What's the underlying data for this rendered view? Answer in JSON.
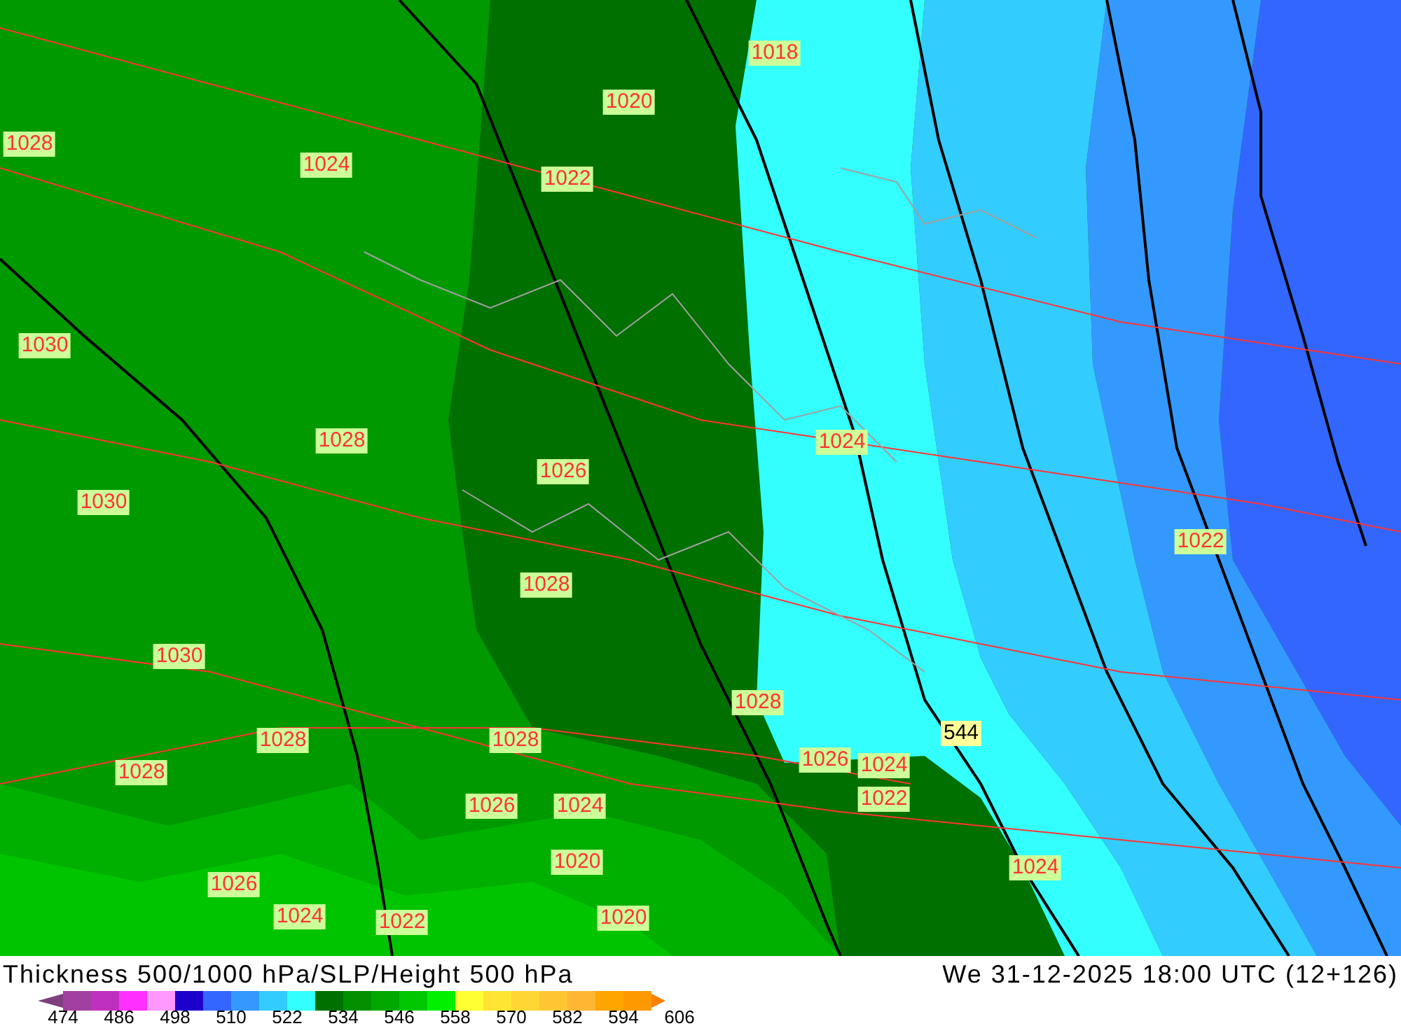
{
  "map": {
    "labels": [
      {
        "text": "1018",
        "kind": "pressure"
      },
      {
        "text": "1020",
        "kind": "pressure"
      },
      {
        "text": "1028",
        "kind": "pressure"
      },
      {
        "text": "1024",
        "kind": "pressure"
      },
      {
        "text": "1022",
        "kind": "pressure"
      },
      {
        "text": "1030",
        "kind": "pressure"
      },
      {
        "text": "1028",
        "kind": "pressure"
      },
      {
        "text": "1024",
        "kind": "pressure"
      },
      {
        "text": "1026",
        "kind": "pressure"
      },
      {
        "text": "1030",
        "kind": "pressure"
      },
      {
        "text": "1022",
        "kind": "pressure"
      },
      {
        "text": "1028",
        "kind": "pressure"
      },
      {
        "text": "1030",
        "kind": "pressure"
      },
      {
        "text": "1028",
        "kind": "pressure"
      },
      {
        "text": "544",
        "kind": "thickness"
      },
      {
        "text": "1028",
        "kind": "pressure"
      },
      {
        "text": "1028",
        "kind": "pressure"
      },
      {
        "text": "1026",
        "kind": "pressure"
      },
      {
        "text": "1024",
        "kind": "pressure"
      },
      {
        "text": "1028",
        "kind": "pressure"
      },
      {
        "text": "1022",
        "kind": "pressure"
      },
      {
        "text": "1026",
        "kind": "pressure"
      },
      {
        "text": "1024",
        "kind": "pressure"
      },
      {
        "text": "1020",
        "kind": "pressure"
      },
      {
        "text": "1024",
        "kind": "pressure"
      },
      {
        "text": "1026",
        "kind": "pressure"
      },
      {
        "text": "1024",
        "kind": "pressure"
      },
      {
        "text": "1022",
        "kind": "pressure"
      },
      {
        "text": "1020",
        "kind": "pressure"
      }
    ]
  },
  "title": "Thickness 500/1000 hPa/SLP/Height 500 hPa",
  "valid_time": "We 31-12-2025 18:00 UTC (12+126)",
  "legend": {
    "swatches": [
      {
        "color": "#a040a0"
      },
      {
        "color": "#c030c0"
      },
      {
        "color": "#ff30ff"
      },
      {
        "color": "#ff99ff"
      },
      {
        "color": "#1e00cc"
      },
      {
        "color": "#3366ff"
      },
      {
        "color": "#3399ff"
      },
      {
        "color": "#33ccff"
      },
      {
        "color": "#33ffff"
      },
      {
        "color": "#007000"
      },
      {
        "color": "#009000"
      },
      {
        "color": "#00a800"
      },
      {
        "color": "#00c800"
      },
      {
        "color": "#00f000"
      },
      {
        "color": "#ffff33"
      },
      {
        "color": "#ffe533"
      },
      {
        "color": "#ffd633"
      },
      {
        "color": "#ffc733"
      },
      {
        "color": "#ffb733"
      },
      {
        "color": "#ffa500"
      },
      {
        "color": "#ff9900"
      }
    ],
    "ticks": [
      "474",
      "486",
      "498",
      "510",
      "522",
      "534",
      "546",
      "558",
      "570",
      "582",
      "594",
      "606"
    ]
  }
}
